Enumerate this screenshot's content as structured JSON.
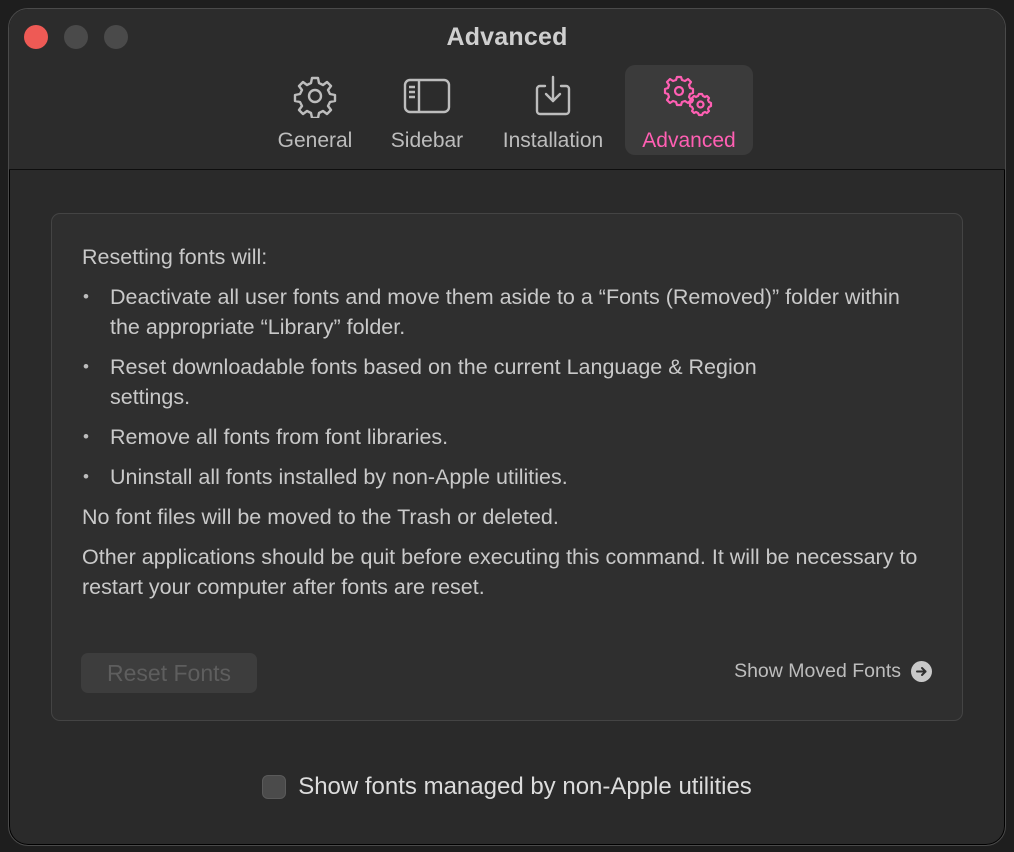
{
  "window": {
    "title": "Advanced"
  },
  "tabs": [
    {
      "label": "General",
      "icon": "gear-icon",
      "active": false
    },
    {
      "label": "Sidebar",
      "icon": "sidebar-icon",
      "active": false
    },
    {
      "label": "Installation",
      "icon": "download-tray-icon",
      "active": false
    },
    {
      "label": "Advanced",
      "icon": "gears-icon",
      "active": true
    }
  ],
  "panel": {
    "intro": "Resetting fonts will:",
    "bullets": [
      "Deactivate all user fonts and move them aside to a “Fonts (Removed)” folder within the appropriate “Library” folder.",
      "Reset downloadable fonts based on the current Language & Region settings.",
      "Remove all fonts from font libraries.",
      "Uninstall all fonts installed by non-Apple utilities."
    ],
    "note1": "No font files will be moved to the Trash or deleted.",
    "note2": "Other applications should be quit before executing this command. It will be necessary to restart your computer after fonts are reset.",
    "reset_button": "Reset Fonts",
    "moved_link": "Show Moved Fonts"
  },
  "footer": {
    "checkbox_label": "Show fonts managed by non-Apple utilities",
    "checked": false
  },
  "colors": {
    "accent": "#ff5fb3",
    "close": "#ee5a55"
  }
}
